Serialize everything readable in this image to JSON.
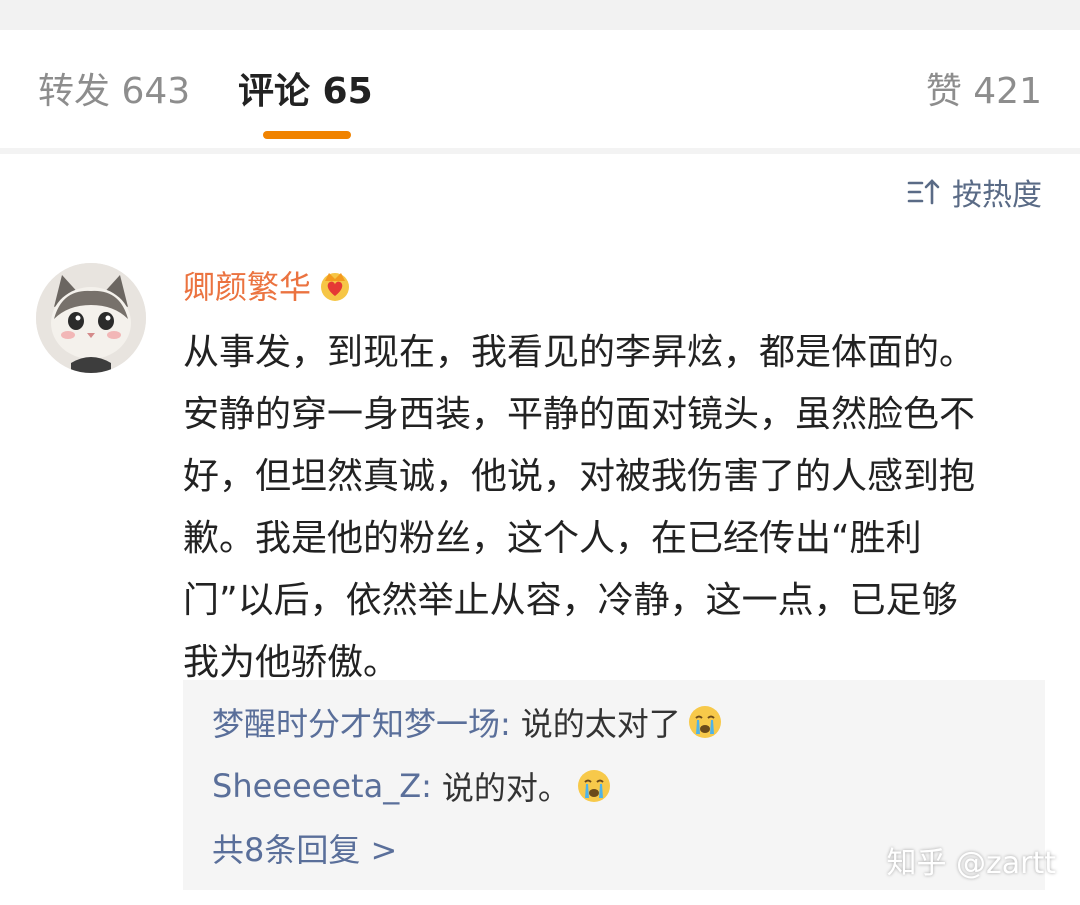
{
  "tabs": {
    "repost": "转发 643",
    "comments": "评论 65",
    "likes": "赞 421",
    "active": "comments",
    "accent_color": "#f08300"
  },
  "sort": {
    "label": "按热度",
    "icon": "sort-icon"
  },
  "comment": {
    "avatar": "cat-avatar",
    "author": "卿颜繁华",
    "author_color": "#eb7340",
    "badge_icon": "crown-icon",
    "lines": [
      "从事发，到现在，我看见的李昇炫，都是体面的。",
      "安静的穿一身西装，平静的面对镜头，虽然脸色不",
      "好，但坦然真诚，他说，对被我伤害了的人感到抱",
      "歉。我是他的粉丝，这个人，在已经传出“胜利",
      "门”以后，依然举止从容，冷静，这一点，已足够",
      "我为他骄傲。"
    ]
  },
  "replies": [
    {
      "name": "梦醒时分才知梦一场:",
      "text": "说的太对了",
      "emoji": "crying-emoji"
    },
    {
      "name": "Sheeeeeta_Z:",
      "text": "说的对。",
      "emoji": "crying-emoji"
    }
  ],
  "more_replies": "共8条回复 >",
  "watermark": "知乎 @zartt"
}
